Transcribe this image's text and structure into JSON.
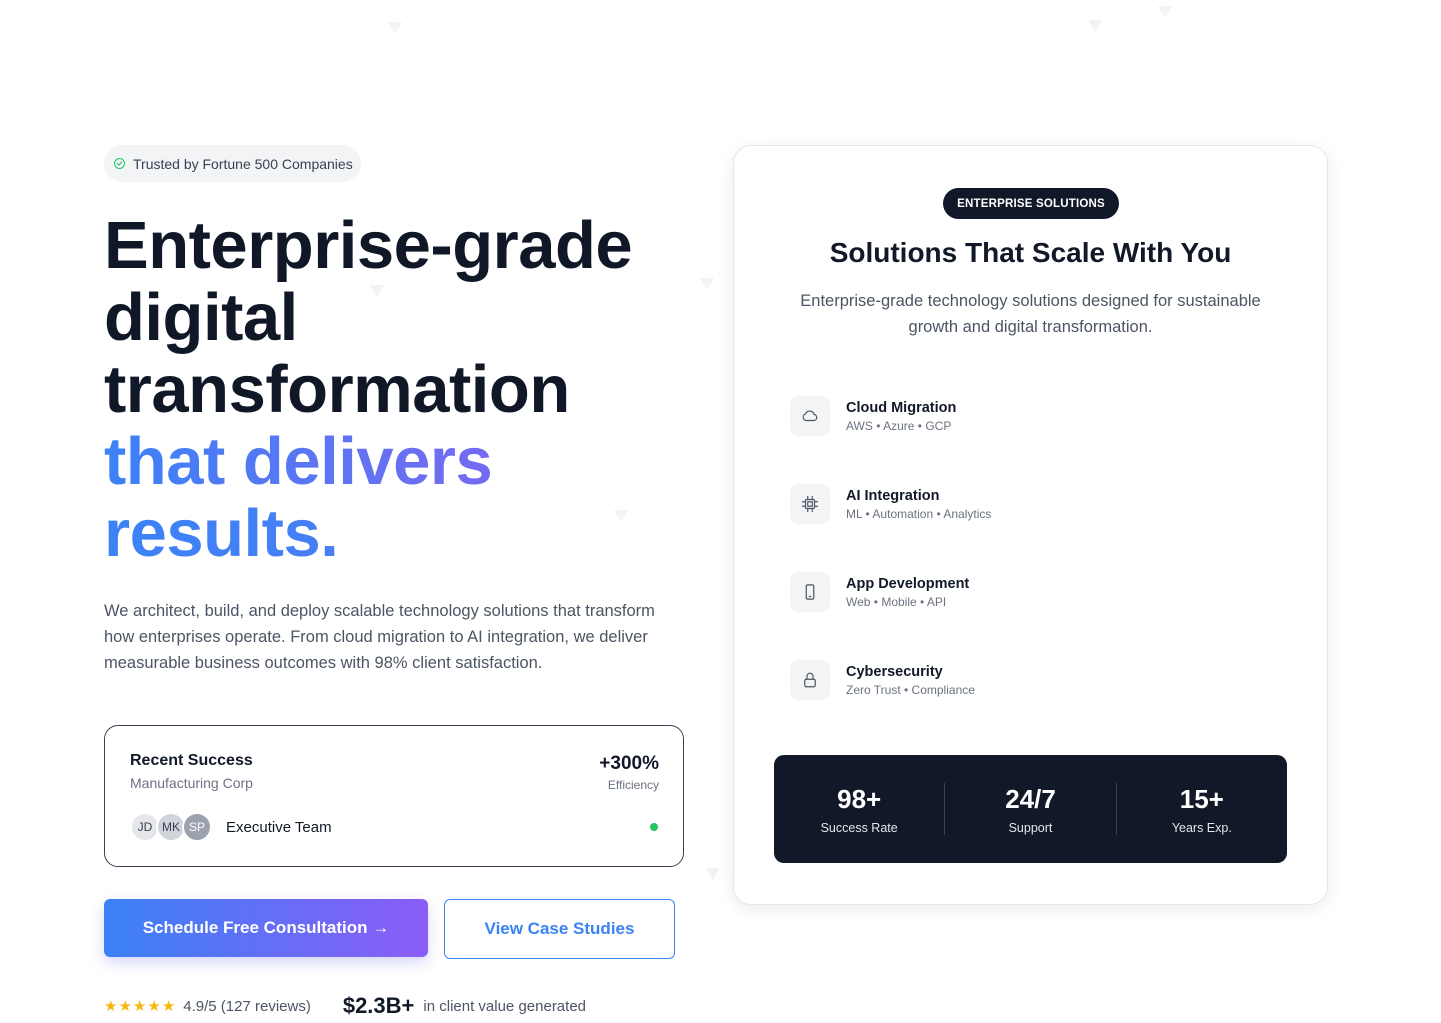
{
  "trust_badge": {
    "label": "Trusted by Fortune 500 Companies",
    "icon": "check-circle-icon"
  },
  "hero": {
    "line1": "Enterprise-grade",
    "line2": "digital",
    "line3": "transformation",
    "line4": "that delivers",
    "line5": "results.",
    "description": "We architect, build, and deploy scalable technology solutions that transform how enterprises operate. From cloud migration to AI integration, we deliver measurable business outcomes with 98% client satisfaction."
  },
  "success_card": {
    "title": "Recent Success",
    "subtitle": "Manufacturing Corp",
    "metric": "+300%",
    "metric_label": "Efficiency",
    "avatars": [
      "JD",
      "MK",
      "SP"
    ],
    "team_label": "Executive Team",
    "status_color": "#22c55e"
  },
  "buttons": {
    "primary": "Schedule Free Consultation →",
    "secondary": "View Case Studies"
  },
  "social_proof": {
    "stars": 5,
    "rating": "4.9/5 (127 reviews)",
    "value": "$2.3B+",
    "value_label": "in client value generated"
  },
  "solutions_card": {
    "badge": "ENTERPRISE SOLUTIONS",
    "title": "Solutions That Scale With You",
    "description": "Enterprise-grade technology solutions designed for sustainable growth and digital transformation.",
    "services": [
      {
        "name": "Cloud Migration",
        "tags": "AWS • Azure • GCP",
        "icon": "cloud-icon"
      },
      {
        "name": "AI Integration",
        "tags": "ML • Automation • Analytics",
        "icon": "cpu-icon"
      },
      {
        "name": "App Development",
        "tags": "Web • Mobile • API",
        "icon": "smartphone-icon"
      },
      {
        "name": "Cybersecurity",
        "tags": "Zero Trust • Compliance",
        "icon": "lock-icon"
      }
    ],
    "stats": [
      {
        "value": "98+",
        "label": "Success Rate"
      },
      {
        "value": "24/7",
        "label": "Support"
      },
      {
        "value": "15+",
        "label": "Years Exp."
      }
    ]
  },
  "colors": {
    "accent_blue": "#3b82f6",
    "accent_purple": "#8b5cf6",
    "dark": "#111827",
    "success_green": "#22c55e",
    "star_yellow": "#f5b90b"
  }
}
